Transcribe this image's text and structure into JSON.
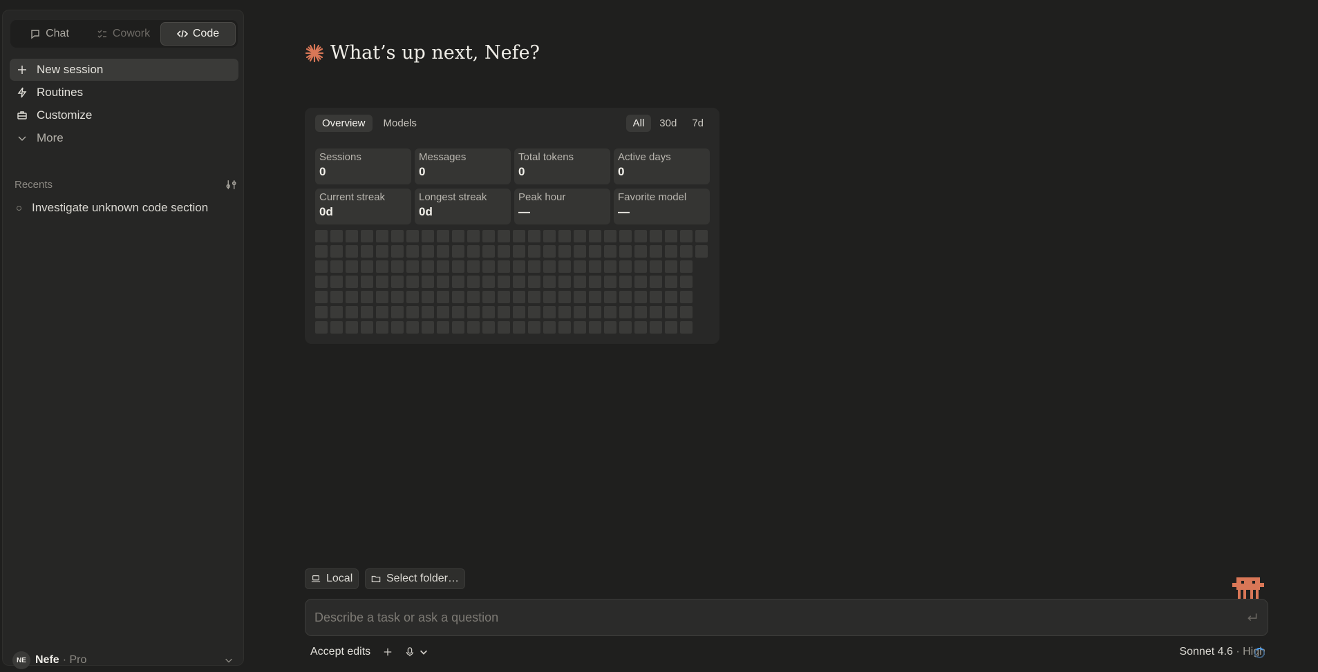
{
  "modes": [
    {
      "label": "Chat",
      "icon": "chat-bubble-icon"
    },
    {
      "label": "Cowork",
      "icon": "checklist-icon"
    },
    {
      "label": "Code",
      "icon": "code-icon"
    }
  ],
  "nav": {
    "new_session": "New session",
    "routines": "Routines",
    "customize": "Customize",
    "more": "More"
  },
  "recents": {
    "title": "Recents",
    "items": [
      "Investigate unknown code section"
    ]
  },
  "user": {
    "initials": "NE",
    "name": "Nefe",
    "plan": "· Pro"
  },
  "greeting": "What’s up next, Nefe?",
  "stats": {
    "tabs": [
      "Overview",
      "Models"
    ],
    "ranges": [
      "All",
      "30d",
      "7d"
    ],
    "cards": [
      {
        "label": "Sessions",
        "value": "0"
      },
      {
        "label": "Messages",
        "value": "0"
      },
      {
        "label": "Total tokens",
        "value": "0"
      },
      {
        "label": "Active days",
        "value": "0"
      },
      {
        "label": "Current streak",
        "value": "0d"
      },
      {
        "label": "Longest streak",
        "value": "0d"
      },
      {
        "label": "Peak hour",
        "value": "—"
      },
      {
        "label": "Favorite model",
        "value": "—"
      }
    ]
  },
  "composer": {
    "env": "Local",
    "folder": "Select folder…",
    "placeholder": "Describe a task or ask a question",
    "accept": "Accept edits",
    "model": "Sonnet 4.6",
    "effort": "· High"
  },
  "colors": {
    "accent": "#d97757",
    "background": "#1f1f1e",
    "spinner": "#4aa3ff"
  }
}
